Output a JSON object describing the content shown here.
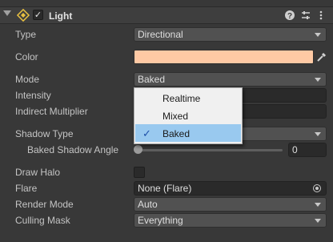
{
  "component": {
    "title": "Light",
    "icons": {
      "fold": "triangle-down-icon",
      "light": "light-component-icon",
      "help": "help-icon",
      "preset": "preset-icon",
      "menu": "kebab-menu-icon"
    },
    "enabled_mark": "✓"
  },
  "rows": {
    "type": {
      "label": "Type",
      "value": "Directional"
    },
    "color": {
      "label": "Color",
      "value_color": "#ffc9a4"
    },
    "mode": {
      "label": "Mode",
      "value": "Baked"
    },
    "intensity": {
      "label": "Intensity"
    },
    "indirect": {
      "label": "Indirect Multiplier"
    },
    "shadow_type": {
      "label": "Shadow Type"
    },
    "baked_shadow_angle": {
      "label": "Baked Shadow Angle",
      "value": "0",
      "slider_fraction": 0
    },
    "draw_halo": {
      "label": "Draw Halo",
      "checked": false
    },
    "flare": {
      "label": "Flare",
      "value": "None (Flare)"
    },
    "render_mode": {
      "label": "Render Mode",
      "value": "Auto"
    },
    "culling_mask": {
      "label": "Culling Mask",
      "value": "Everything"
    }
  },
  "mode_dropdown": {
    "options": [
      "Realtime",
      "Mixed",
      "Baked"
    ],
    "selected": "Baked",
    "selected_mark": "✓"
  }
}
